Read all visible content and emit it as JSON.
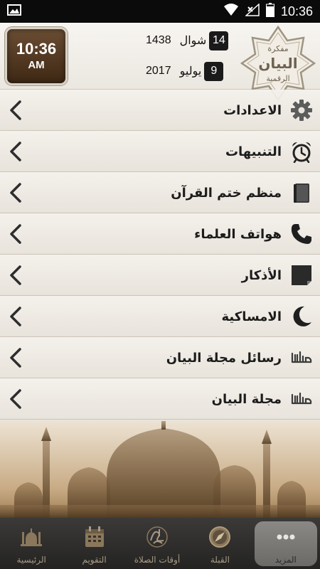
{
  "status_bar": {
    "time": "10:36",
    "icons": [
      "image-icon",
      "wifi-icon",
      "no-signal-icon",
      "battery-icon"
    ]
  },
  "header": {
    "clock": {
      "time": "10:36",
      "ampm": "AM"
    },
    "hijri": {
      "day": "14",
      "month": "شوال",
      "year": "1438"
    },
    "gregorian": {
      "day": "9",
      "month": "يوليو",
      "year": "2017"
    },
    "logo": {
      "top_text": "مفكرة",
      "main_text": "البيان",
      "bottom_text": "الرقمية"
    }
  },
  "menu": [
    {
      "label": "الاعدادات",
      "icon": "gear-icon"
    },
    {
      "label": "التنبيهات",
      "icon": "alarm-clock-icon"
    },
    {
      "label": "منظم ختم القرآن",
      "icon": "book-icon"
    },
    {
      "label": "هواتف العلماء",
      "icon": "phone-icon"
    },
    {
      "label": "الأذكار",
      "icon": "note-icon"
    },
    {
      "label": "الامساكية",
      "icon": "crescent-icon"
    },
    {
      "label": "رسائل مجلة البيان",
      "icon": "albayan-logo-icon"
    },
    {
      "label": "مجلة البيان",
      "icon": "albayan-logo-icon"
    }
  ],
  "bottom_nav": [
    {
      "label": "المزيد",
      "icon": "more-dots-icon",
      "active": true
    },
    {
      "label": "القبلة",
      "icon": "compass-icon",
      "active": false
    },
    {
      "label": "أوقات الصلاة",
      "icon": "calligraphy-icon",
      "active": false
    },
    {
      "label": "التقويم",
      "icon": "calendar-icon",
      "active": false
    },
    {
      "label": "الرئيسية",
      "icon": "mosque-icon",
      "active": false
    }
  ],
  "colors": {
    "clock_bg": "#4e341c",
    "nav_bg": "#2e2d2b",
    "nav_label": "#a89a85",
    "menu_text": "#1c1c1c"
  }
}
